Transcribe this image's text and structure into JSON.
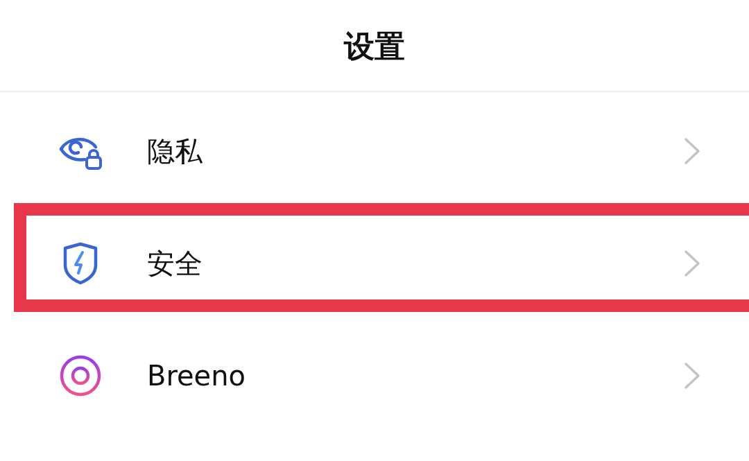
{
  "header": {
    "title": "设置"
  },
  "items": [
    {
      "kind": "privacy",
      "label": "隐私",
      "highlighted": false
    },
    {
      "kind": "security",
      "label": "安全",
      "highlighted": true
    },
    {
      "kind": "assistant",
      "label": "Breeno",
      "highlighted": false
    }
  ]
}
